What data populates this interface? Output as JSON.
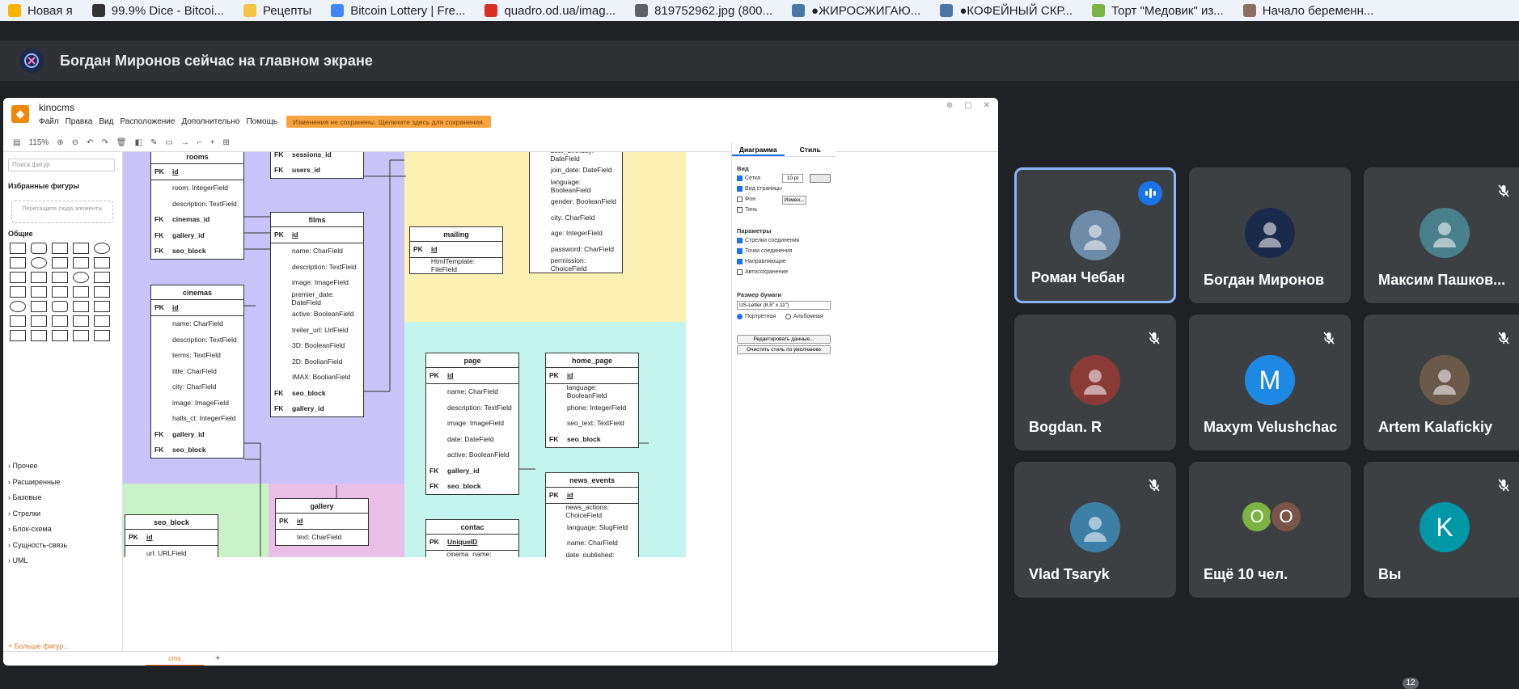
{
  "bookmarks": [
    {
      "label": "Новая я",
      "color": "#f4b400"
    },
    {
      "label": "99.9% Dice - Bitcoi...",
      "color": "#333333"
    },
    {
      "label": "Рецепты",
      "color": "#f4c542"
    },
    {
      "label": "Bitcoin Lottery | Fre...",
      "color": "#4285f4"
    },
    {
      "label": "quadro.od.ua/imag...",
      "color": "#d93025"
    },
    {
      "label": "819752962.jpg (800...",
      "color": "#5f6368"
    },
    {
      "label": "●ЖИРОСЖИГАЮ...",
      "color": "#4a76a8"
    },
    {
      "label": "●КОФЕЙНЫЙ СКР...",
      "color": "#4a76a8"
    },
    {
      "label": "Торт \"Медовик\" из...",
      "color": "#7cb342"
    },
    {
      "label": "Начало беременн...",
      "color": "#8d6e63"
    }
  ],
  "banner": {
    "text": "Богдан Миронов сейчас на главном экране"
  },
  "drawio": {
    "title": "kinocms",
    "menu": [
      "Файл",
      "Правка",
      "Вид",
      "Расположение",
      "Дополнительно",
      "Помощь"
    ],
    "warning": "Изменения не сохранены. Щелкните здесь для сохранения.",
    "zoom": "115%",
    "search_placeholder": "Поиск фигур",
    "favorites": "Избранные фигуры",
    "drop_zone": "Перетащите сюда элементы",
    "general": "Общие",
    "categories": [
      "Прочее",
      "Расширенные",
      "Базовые",
      "Стрелки",
      "Блок-схема",
      "Сущность-связь",
      "UML"
    ],
    "more_shapes": "+ Больше фигур...",
    "page_tab": "cms",
    "format": {
      "tab_diagram": "Диаграмма",
      "tab_style": "Стиль",
      "view": "Вид",
      "grid": "Сетка",
      "grid_size": "10 pt",
      "page_view": "Вид страницы",
      "background": "Фон",
      "change": "Измен...",
      "shadow": "Тень",
      "options": "Параметры",
      "connection_arrows": "Стрелки соединения",
      "connection_points": "Точки соединения",
      "guides": "Направляющие",
      "autosave": "Автосохранение",
      "paper_size": "Размер бумаги",
      "paper_value": "US-Letter (8,5\" x 11\")",
      "portrait": "Портретная",
      "landscape": "Альбомная",
      "edit_data": "Редактировать данные...",
      "reset_style": "Очистить стиль по умолчанию"
    }
  },
  "tables": {
    "rooms": {
      "title": "rooms",
      "rows": [
        [
          "PK",
          "id"
        ],
        [
          "",
          "room: IntegerField"
        ],
        [
          "",
          "description: TextField"
        ],
        [
          "FK",
          "cinemas_id"
        ],
        [
          "FK",
          "gallery_id"
        ],
        [
          "FK",
          "seo_block"
        ]
      ]
    },
    "sessions": {
      "rows": [
        [
          "FK",
          "sessions_id"
        ],
        [
          "FK",
          "users_id"
        ]
      ]
    },
    "films": {
      "title": "films",
      "rows": [
        [
          "PK",
          "id"
        ],
        [
          "",
          "name: CharField"
        ],
        [
          "",
          "description: TextField"
        ],
        [
          "",
          "image: ImageField"
        ],
        [
          "",
          "premier_date: DateField"
        ],
        [
          "",
          "active: BooleanField"
        ],
        [
          "",
          "treiler_url: UrlField"
        ],
        [
          "",
          "3D: BooleanField"
        ],
        [
          "",
          "2D: BoolianField"
        ],
        [
          "",
          "IMAX: BoolianField"
        ],
        [
          "FK",
          "seo_block"
        ],
        [
          "FK",
          "gallery_id"
        ]
      ]
    },
    "cinemas": {
      "title": "cinemas",
      "rows": [
        [
          "PK",
          "id"
        ],
        [
          "",
          "name: CharField"
        ],
        [
          "",
          "description: TextField"
        ],
        [
          "",
          "terms: TextField"
        ],
        [
          "",
          "title: CharField"
        ],
        [
          "",
          "city: CharField"
        ],
        [
          "",
          "image: ImageField"
        ],
        [
          "",
          "halls_ct: IntegerField"
        ],
        [
          "FK",
          "gallery_id"
        ],
        [
          "FK",
          "seo_block"
        ]
      ]
    },
    "mailing": {
      "title": "mailing",
      "rows": [
        [
          "PK",
          "id"
        ],
        [
          "",
          "HtmlTemplate: FileField"
        ]
      ]
    },
    "users": {
      "rows": [
        [
          "",
          "date_birthday: DateField"
        ],
        [
          "",
          "join_date: DateField"
        ],
        [
          "",
          "language: BooleanField"
        ],
        [
          "",
          "gender: BooleanField"
        ],
        [
          "",
          "city: CharField"
        ],
        [
          "",
          "age: IntegerField"
        ],
        [
          "",
          "password: CharField"
        ],
        [
          "",
          "permission: ChoiceField"
        ]
      ]
    },
    "page": {
      "title": "page",
      "rows": [
        [
          "PK",
          "id"
        ],
        [
          "",
          "name: CharField"
        ],
        [
          "",
          "description: TextField"
        ],
        [
          "",
          "image: ImageField"
        ],
        [
          "",
          "date: DateField"
        ],
        [
          "",
          "active: BooleanField"
        ],
        [
          "FK",
          "gallery_id"
        ],
        [
          "FK",
          "seo_block"
        ]
      ]
    },
    "home_page": {
      "title": "home_page",
      "rows": [
        [
          "PK",
          "id"
        ],
        [
          "",
          "language: BooleanField"
        ],
        [
          "",
          "phone: IntegerField"
        ],
        [
          "",
          "seo_text: TextField"
        ],
        [
          "FK",
          "seo_block"
        ]
      ]
    },
    "news_events": {
      "title": "news_events",
      "rows": [
        [
          "PK",
          "id"
        ],
        [
          "",
          "news_actions: ChoiceField"
        ],
        [
          "",
          "language: SlugField"
        ],
        [
          "",
          "name: CharField"
        ],
        [
          "",
          "date_published: DateField"
        ]
      ]
    },
    "gallery": {
      "title": "gallery",
      "rows": [
        [
          "PK",
          "id"
        ],
        [
          "",
          "text: CharField"
        ]
      ]
    },
    "seo_block": {
      "title": "seo_block",
      "rows": [
        [
          "PK",
          "id"
        ],
        [
          "",
          "url: URLField"
        ]
      ]
    },
    "contac": {
      "title": "contac",
      "rows": [
        [
          "PK",
          "UniqueID"
        ],
        [
          "",
          "cinema_name: CharField"
        ]
      ]
    }
  },
  "participants": [
    {
      "name": "Роман Чебан",
      "initial": "",
      "color": "#6d8ba8",
      "state": "speaking"
    },
    {
      "name": "Богдан Миронов",
      "initial": "",
      "color": "#1a2a4a",
      "state": "none"
    },
    {
      "name": "Максим Пашков...",
      "initial": "",
      "color": "#4a7f8c",
      "state": "muted"
    },
    {
      "name": "Bogdan. R",
      "initial": "",
      "color": "#8a3b35",
      "state": "muted"
    },
    {
      "name": "Maxym Velushchac",
      "initial": "M",
      "color": "#1e88e5",
      "state": "muted"
    },
    {
      "name": "Artem Kalafickiy",
      "initial": "",
      "color": "#6b5a4a",
      "state": "muted"
    },
    {
      "name": "Vlad Tsaryk",
      "initial": "",
      "color": "#3e7fa6",
      "state": "muted"
    },
    {
      "name": "Ещё 10 чел.",
      "initial": "",
      "color": "",
      "state": "none"
    },
    {
      "name": "Вы",
      "initial": "K",
      "color": "#0097a7",
      "state": "muted"
    }
  ],
  "more_avatars": [
    {
      "initial": "O",
      "color": "#7cb342"
    },
    {
      "initial": "O",
      "color": "#795548"
    }
  ],
  "badge_count": "12"
}
